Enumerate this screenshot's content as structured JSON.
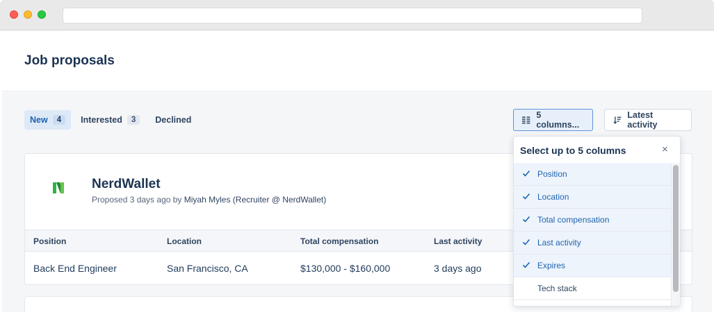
{
  "page": {
    "title": "Job proposals"
  },
  "tabs": [
    {
      "label": "New",
      "count": "4"
    },
    {
      "label": "Interested",
      "count": "3"
    },
    {
      "label": "Declined"
    }
  ],
  "toolbar": {
    "columns_label": "5 columns...",
    "sort_label": "Latest activity"
  },
  "proposal": {
    "company": "NerdWallet",
    "proposed_text": "Proposed 3 days ago by ",
    "recruiter": "Miyah Myles (Recruiter @ NerdWallet)",
    "columns": [
      "Position",
      "Location",
      "Total compensation",
      "Last activity"
    ],
    "row": [
      "Back End Engineer",
      "San Francisco, CA",
      "$130,000 - $160,000",
      "3 days ago"
    ]
  },
  "column_picker": {
    "title": "Select up to 5 columns",
    "close": "×",
    "options": [
      {
        "label": "Position",
        "checked": true
      },
      {
        "label": "Location",
        "checked": true
      },
      {
        "label": "Total compensation",
        "checked": true
      },
      {
        "label": "Last activity",
        "checked": true
      },
      {
        "label": "Expires",
        "checked": true
      },
      {
        "label": "Tech stack",
        "checked": false
      }
    ]
  },
  "colors": {
    "accent": "#1f63b0",
    "heading": "#1b3352",
    "logo_green": "#2fb34a"
  },
  "icons": {
    "columns_button": "columns-icon",
    "sort_button": "sort-icon",
    "close": "close-icon",
    "check": "check-icon"
  }
}
